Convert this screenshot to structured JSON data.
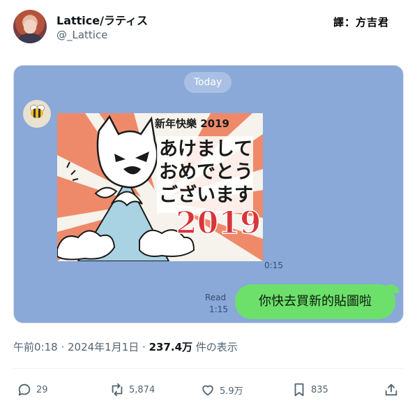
{
  "author": {
    "display_name": "Lattice/ラティス",
    "handle": "@_Lattice"
  },
  "translator_credit": "譯：方吉君",
  "chat": {
    "date_pill": "Today",
    "sticker_text": {
      "top": "新年快樂 2019",
      "line1": "あけまして",
      "line2": "おめでとう",
      "line3": "ございます",
      "year": "2019"
    },
    "sticker_time": "0:15",
    "read_label": "Read",
    "read_time": "1:15",
    "message": "你快去買新的貼圖啦"
  },
  "meta": {
    "time_date": "午前0:18 · 2024年1月1日 · ",
    "views": "237.4万",
    "views_suffix": " 件の表示"
  },
  "actions": {
    "replies": "29",
    "reposts": "5,874",
    "likes": "5.9万",
    "bookmarks": "835"
  },
  "colors": {
    "chat_bg": "#8aa8d8",
    "bubble": "#6de06c",
    "sticker_sun": "#ee8a6a",
    "sticker_red": "#d9353c"
  }
}
